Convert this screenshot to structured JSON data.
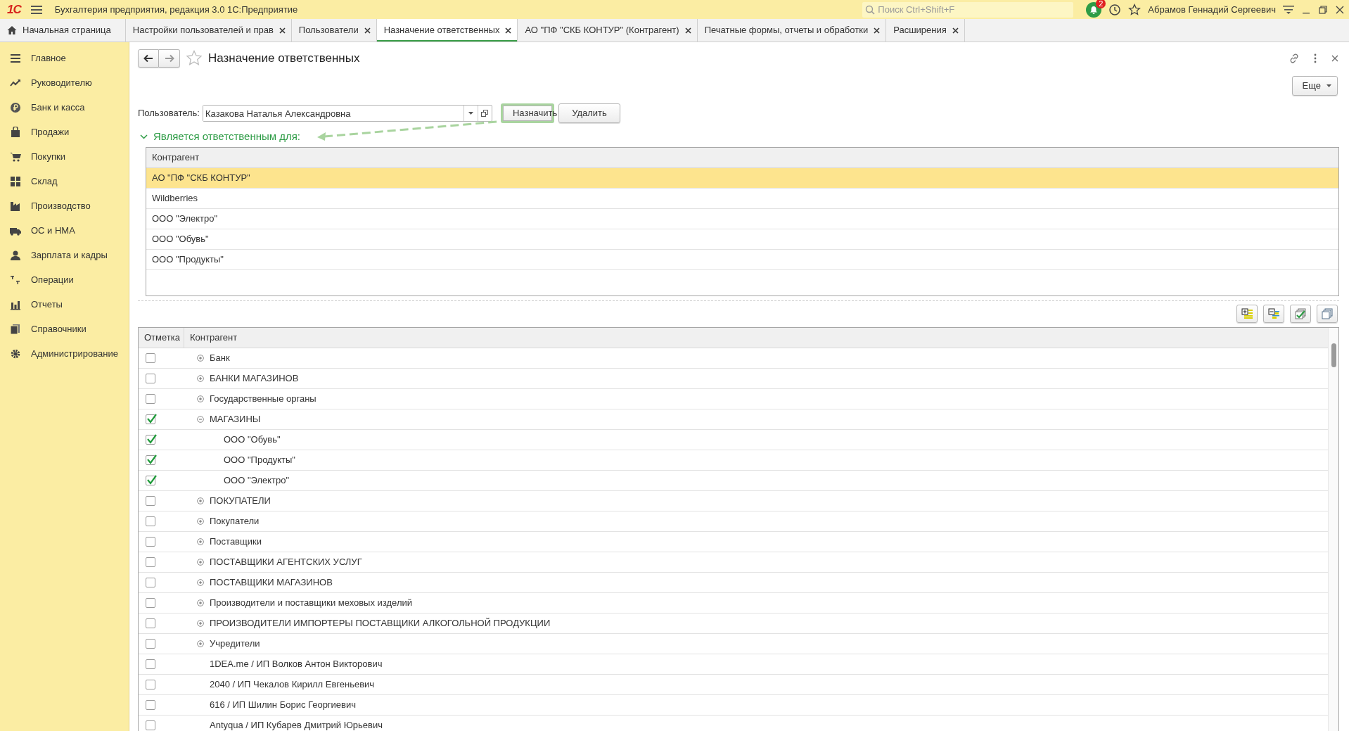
{
  "window": {
    "logo": "1С",
    "title": "Бухгалтерия предприятия, редакция 3.0 1С:Предприятие",
    "search": {
      "placeholder": "Поиск Ctrl+Shift+F"
    },
    "notifications": "2",
    "user": "Абрамов Геннадий Сергеевич"
  },
  "tabs": [
    {
      "kind": "home",
      "label": "Начальная страница",
      "selected": false
    },
    {
      "kind": "doc",
      "label": "Настройки пользователей и прав",
      "selected": false
    },
    {
      "kind": "doc",
      "label": "Пользователи",
      "selected": false
    },
    {
      "kind": "doc",
      "label": "Назначение ответственных",
      "selected": true
    },
    {
      "kind": "doc",
      "label": "АО \"ПФ \"СКБ КОНТУР\" (Контрагент)",
      "selected": false
    },
    {
      "kind": "doc",
      "label": "Печатные формы, отчеты и обработки",
      "selected": false
    },
    {
      "kind": "doc",
      "label": "Расширения",
      "selected": false
    }
  ],
  "sidebar": {
    "items": [
      {
        "label": "Главное"
      },
      {
        "label": "Руководителю"
      },
      {
        "label": "Банк и касса"
      },
      {
        "label": "Продажи"
      },
      {
        "label": "Покупки"
      },
      {
        "label": "Склад"
      },
      {
        "label": "Производство"
      },
      {
        "label": "ОС и НМА"
      },
      {
        "label": "Зарплата и кадры"
      },
      {
        "label": "Операции"
      },
      {
        "label": "Отчеты"
      },
      {
        "label": "Справочники"
      },
      {
        "label": "Администрирование"
      }
    ]
  },
  "form": {
    "title": "Назначение ответственных",
    "more_button": "Еще",
    "user_label": "Пользователь:",
    "user_value": "Казакова Наталья Александровна",
    "buttons": [
      {
        "label": "Назначить",
        "highlighted": true
      },
      {
        "label": "Удалить",
        "highlighted": false
      }
    ],
    "section": {
      "title": "Является ответственным для:",
      "expanded": true
    },
    "assigned_table": {
      "columns": [
        "Контрагент"
      ],
      "rows": [
        {
          "name": "АО \"ПФ \"СКБ КОНТУР\"",
          "selected": true
        },
        {
          "name": "Wildberries",
          "selected": false
        },
        {
          "name": "ООО \"Электро\"",
          "selected": false
        },
        {
          "name": "ООО \"Обувь\"",
          "selected": false
        },
        {
          "name": "ООО \"Продукты\"",
          "selected": false
        }
      ]
    },
    "tree": {
      "columns": [
        "Отметка",
        "Контрагент"
      ],
      "rows": [
        {
          "kind": "group",
          "name": "Банк",
          "checked": false,
          "expanded": false
        },
        {
          "kind": "group",
          "name": "БАНКИ МАГАЗИНОВ",
          "checked": false,
          "expanded": false
        },
        {
          "kind": "group",
          "name": "Государственные органы",
          "checked": false,
          "expanded": false
        },
        {
          "kind": "group",
          "name": "МАГАЗИНЫ",
          "checked": true,
          "expanded": true,
          "children": [
            {
              "kind": "item",
              "name": "ООО \"Обувь\"",
              "checked": true
            },
            {
              "kind": "item",
              "name": "ООО \"Продукты\"",
              "checked": true
            },
            {
              "kind": "item",
              "name": "ООО \"Электро\"",
              "checked": true
            }
          ]
        },
        {
          "kind": "group",
          "name": "ПОКУПАТЕЛИ",
          "checked": false,
          "expanded": false
        },
        {
          "kind": "group",
          "name": "Покупатели",
          "checked": false,
          "expanded": false
        },
        {
          "kind": "group",
          "name": "Поставщики",
          "checked": false,
          "expanded": false
        },
        {
          "kind": "group",
          "name": "ПОСТАВЩИКИ АГЕНТСКИХ УСЛУГ",
          "checked": false,
          "expanded": false
        },
        {
          "kind": "group",
          "name": "ПОСТАВЩИКИ МАГАЗИНОВ",
          "checked": false,
          "expanded": false
        },
        {
          "kind": "group",
          "name": "Производители и поставщики меховых изделий",
          "checked": false,
          "expanded": false
        },
        {
          "kind": "group",
          "name": "ПРОИЗВОДИТЕЛИ ИМПОРТЕРЫ ПОСТАВЩИКИ АЛКОГОЛЬНОЙ ПРОДУКЦИИ",
          "checked": false,
          "expanded": false
        },
        {
          "kind": "group",
          "name": "Учредители",
          "checked": false,
          "expanded": false
        },
        {
          "kind": "item",
          "name": "1DEA.me / ИП Волков Антон Викторович",
          "checked": false
        },
        {
          "kind": "item",
          "name": "2040 / ИП Чекалов Кирилл Евгеньевич",
          "checked": false
        },
        {
          "kind": "item",
          "name": "616 / ИП Шилин Борис Георгиевич",
          "checked": false
        },
        {
          "kind": "item",
          "name": "Antyqua / ИП Кубарев Дмитрий Юрьевич",
          "checked": false
        }
      ]
    }
  }
}
